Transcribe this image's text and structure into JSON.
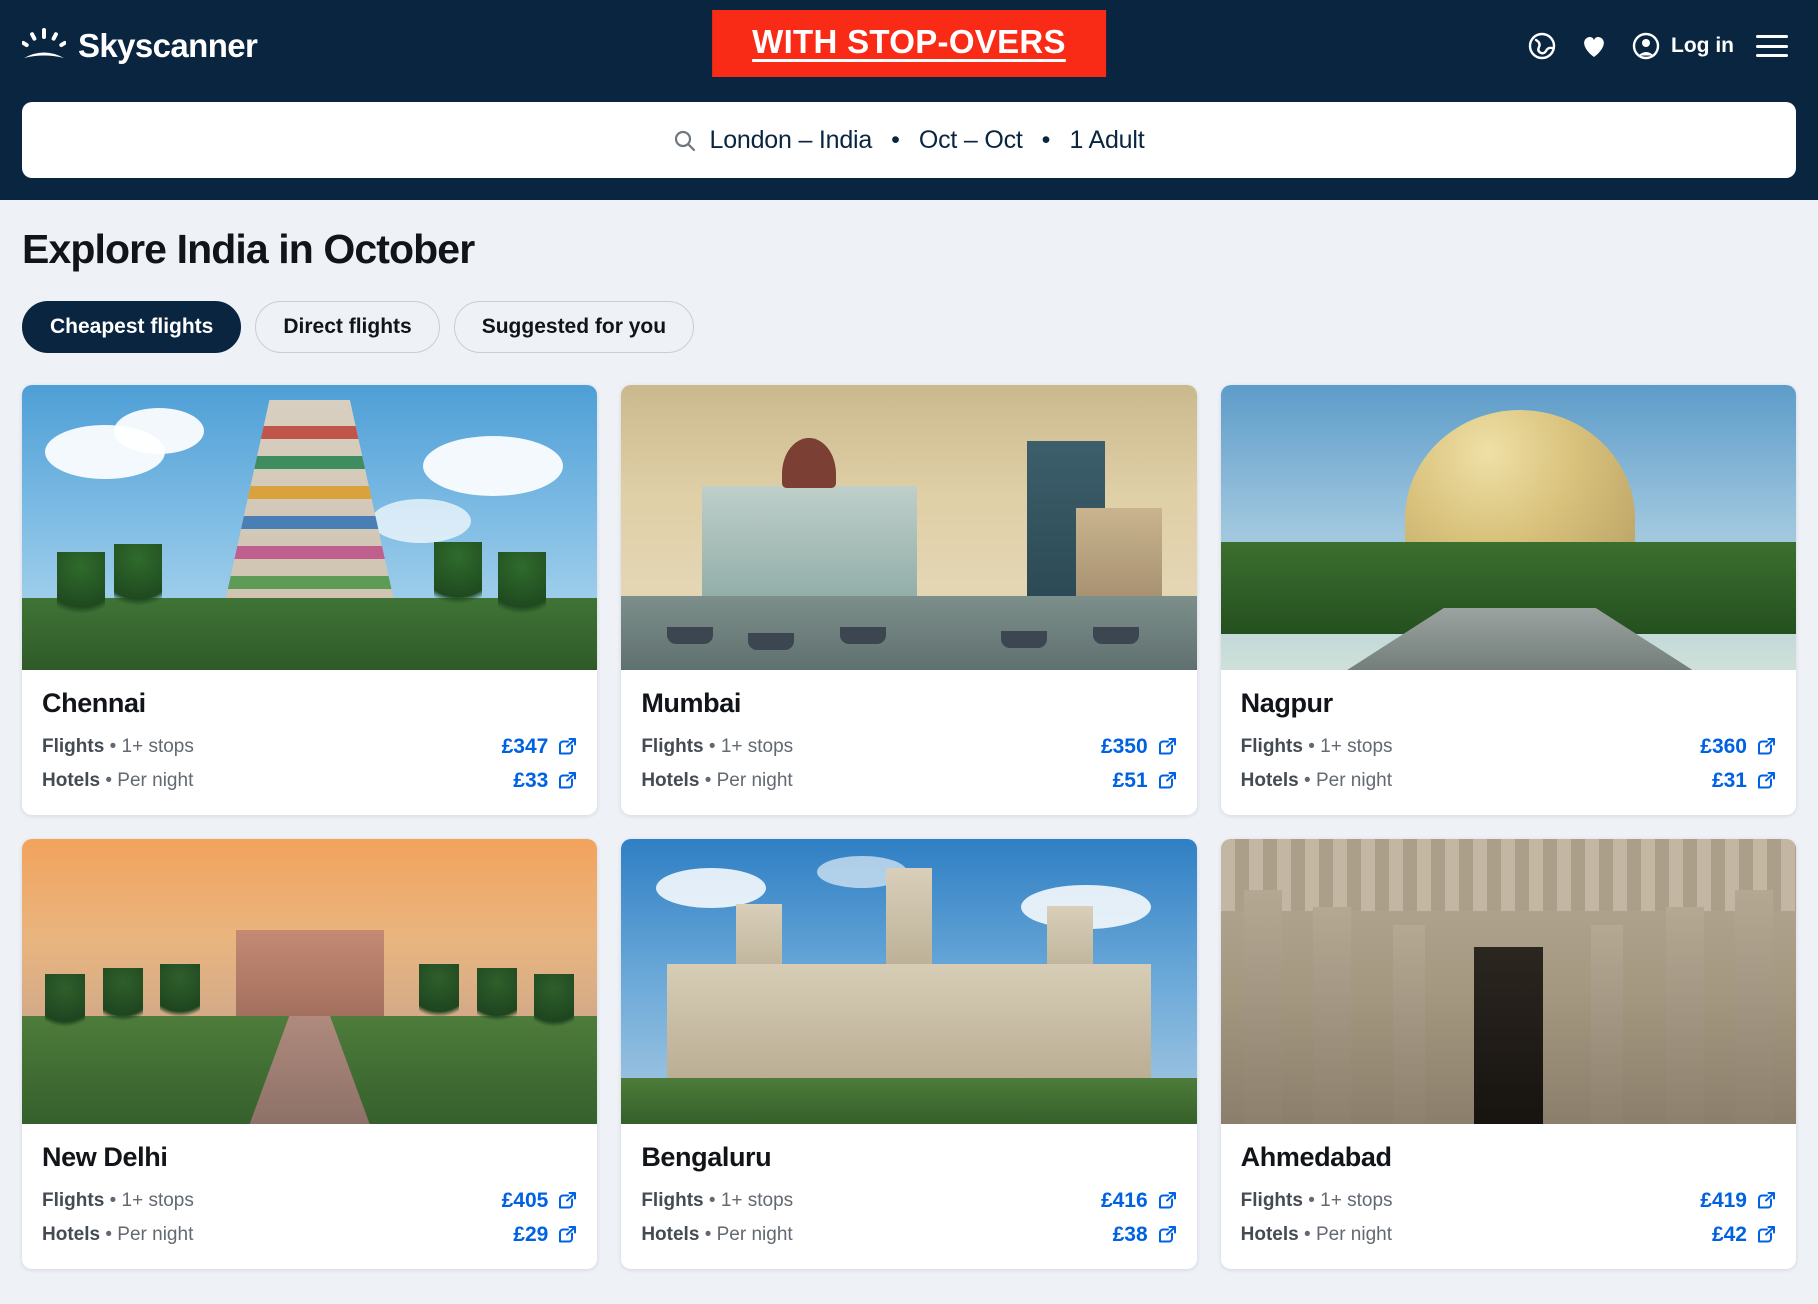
{
  "header": {
    "brand": "Skyscanner",
    "promo_banner": "WITH STOP-OVERS",
    "login_label": "Log in",
    "icons": {
      "globe": "globe-icon",
      "heart": "heart-icon",
      "avatar": "account-avatar-icon",
      "menu": "hamburger-menu-icon"
    }
  },
  "search": {
    "route": "London – India",
    "dates": "Oct – Oct",
    "travellers": "1 Adult",
    "separator": "•"
  },
  "main": {
    "title": "Explore India in October",
    "tabs": [
      {
        "label": "Cheapest flights",
        "active": true
      },
      {
        "label": "Direct flights",
        "active": false
      },
      {
        "label": "Suggested for you",
        "active": false
      }
    ],
    "row_labels": {
      "flights": "Flights",
      "flights_detail": "1+ stops",
      "hotels": "Hotels",
      "hotels_detail": "Per night",
      "bullet": "•"
    },
    "cards": [
      {
        "city": "Chennai",
        "flights_label": "Flights",
        "flights_detail": "1+ stops",
        "flights_price": "£347",
        "hotels_label": "Hotels",
        "hotels_detail": "Per night",
        "hotels_price": "£33"
      },
      {
        "city": "Mumbai",
        "flights_label": "Flights",
        "flights_detail": "1+ stops",
        "flights_price": "£350",
        "hotels_label": "Hotels",
        "hotels_detail": "Per night",
        "hotels_price": "£51"
      },
      {
        "city": "Nagpur",
        "flights_label": "Flights",
        "flights_detail": "1+ stops",
        "flights_price": "£360",
        "hotels_label": "Hotels",
        "hotels_detail": "Per night",
        "hotels_price": "£31"
      },
      {
        "city": "New Delhi",
        "flights_label": "Flights",
        "flights_detail": "1+ stops",
        "flights_price": "£405",
        "hotels_label": "Hotels",
        "hotels_detail": "Per night",
        "hotels_price": "£29"
      },
      {
        "city": "Bengaluru",
        "flights_label": "Flights",
        "flights_detail": "1+ stops",
        "flights_price": "£416",
        "hotels_label": "Hotels",
        "hotels_detail": "Per night",
        "hotels_price": "£38"
      },
      {
        "city": "Ahmedabad",
        "flights_label": "Flights",
        "flights_detail": "1+ stops",
        "flights_price": "£419",
        "hotels_label": "Hotels",
        "hotels_detail": "Per night",
        "hotels_price": "£42"
      }
    ]
  },
  "colors": {
    "header_bg": "#0a2540",
    "promo_bg": "#f92b17",
    "price_blue": "#0062e3",
    "page_bg": "#eef1f6"
  }
}
